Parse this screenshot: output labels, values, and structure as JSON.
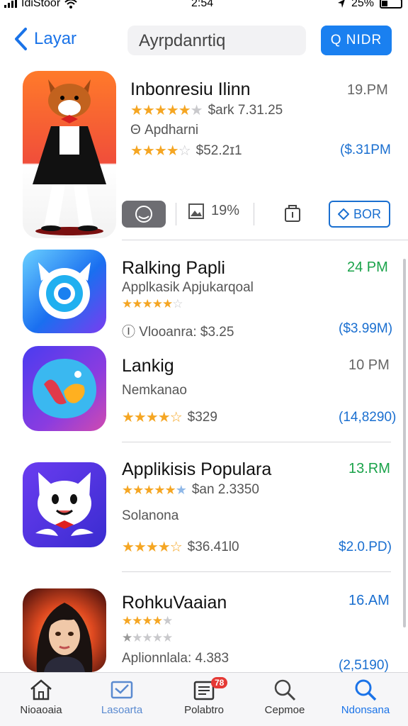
{
  "status_bar": {
    "carrier": "IdiStoor",
    "time": "2:54",
    "battery": "25%"
  },
  "nav": {
    "back_label": "Layar",
    "search_text": "Ayrpdanrtiq",
    "action_label": "Q NIDR"
  },
  "apps": [
    {
      "title": "Inbonresiu Ilinn",
      "time": "19.PM",
      "stars_1": "★★★★★",
      "stars_1_empty": "★",
      "stars_1_text": "$ark 7.31.25",
      "subtitle": "Θ Apdharni",
      "stars_2": "★★★★",
      "stars_2_empty": "☆",
      "stars_2_text": "$52.2ɪ1",
      "price": "($.31PM",
      "action_percent": "19%",
      "action_button": "BOR"
    },
    {
      "title": "Ralking Papli",
      "time": "24 PM",
      "subtitle": "Applkasik Apjukarqoal",
      "stars": "★★★★★",
      "stars_empty": "☆",
      "info": "Ⓘ Vlooanra: $3.25",
      "price": "($3.99M)"
    },
    {
      "title": "Lankig",
      "time": "10 PM",
      "subtitle": "Nemkanao",
      "stars": "★★★★",
      "stars_empty": "☆",
      "stars_text": "$329",
      "price": "(14,8290)"
    },
    {
      "title": "Applikisis Populara",
      "time": "13.RM",
      "stars": "★★★★★",
      "stars_empty": "★",
      "stars_text": "$an 2.3350",
      "subtitle": "Solanona",
      "stars_2": "★★★★",
      "stars_2_empty": "☆",
      "stars_2_text": "$36.41Ɩ0",
      "price": "$2.0.PD)"
    },
    {
      "title": "RohkuVaaian",
      "time": "16.AM",
      "stars": "★★★★",
      "stars_empty": "★",
      "stars_2": "★",
      "stars_2_empty": "★★★★",
      "subtitle": "Aplionnlala: 4.383",
      "price": "(2,5190)"
    }
  ],
  "tabs": [
    {
      "label": "Nioaoaia",
      "icon": "home-icon"
    },
    {
      "label": "Lasoarta",
      "icon": "inbox-icon"
    },
    {
      "label": "Polabtro",
      "icon": "calendar-icon",
      "badge": "78"
    },
    {
      "label": "Cepmoe",
      "icon": "search-icon"
    },
    {
      "label": "Ndonsana",
      "icon": "search-icon"
    }
  ],
  "colors": {
    "accent": "#1a80f0",
    "time_green": "#1aa34a",
    "star": "#f5a623"
  }
}
